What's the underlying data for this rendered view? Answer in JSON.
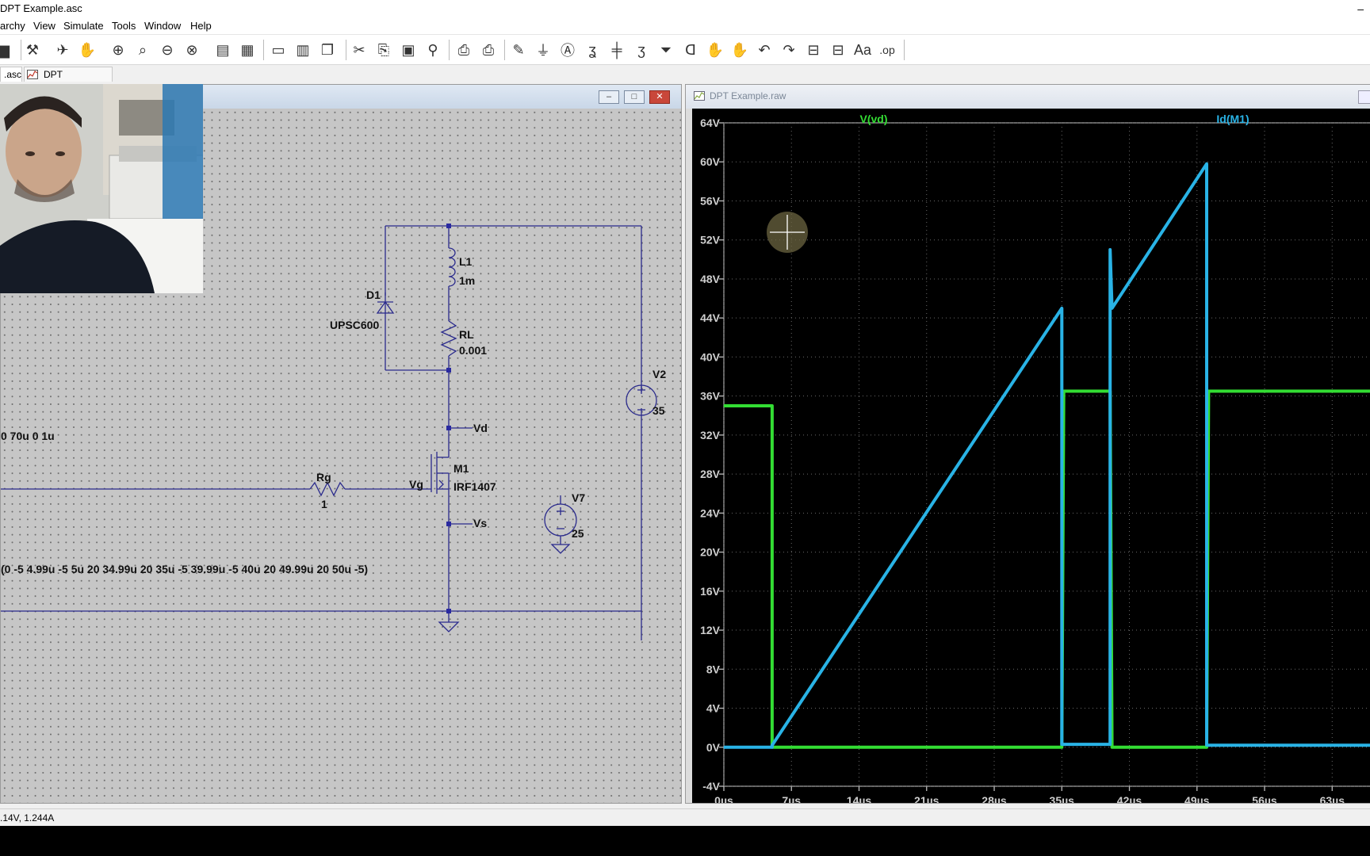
{
  "window": {
    "title": "DPT Example.asc",
    "minimize": "–"
  },
  "menu": [
    "archy",
    "View",
    "Simulate",
    "Tools",
    "Window",
    "Help"
  ],
  "tabs": [
    ".asc",
    "DPT Example.raw"
  ],
  "schematic": {
    "window_buttons": [
      "–",
      "□",
      "✕"
    ],
    "labels": {
      "l1": "L1",
      "l1_val": "1m",
      "d1": "D1",
      "d1_val": "UPSC600",
      "rl": "RL",
      "rl_val": "0.001",
      "v2": "V2",
      "v2_val": "35",
      "vd": "Vd",
      "vs": "Vs",
      "vg": "Vg",
      "m1": "M1",
      "m1_val": "IRF1407",
      "rg": "Rg",
      "rg_val": "1",
      "v7": "V7",
      "v7_val": "25",
      "pulse_frag": "0 70u 0 1u",
      "pwl": "(0 -5 4.99u -5 5u 20 34.99u 20 35u -5 39.99u -5 40u 20 49.99u 20 50u -5)"
    }
  },
  "waveform": {
    "title": "DPT Example.raw",
    "traces": [
      {
        "name": "V(vd)",
        "color": "#33dd33"
      },
      {
        "name": "Id(M1)",
        "color": "#29b3e6"
      }
    ]
  },
  "chart_data": {
    "type": "line",
    "xlabel": "",
    "ylabel": "",
    "xlim": [
      0,
      67
    ],
    "ylim": [
      -4,
      64
    ],
    "x_ticks": [
      "0µs",
      "7µs",
      "14µs",
      "21µs",
      "28µs",
      "35µs",
      "42µs",
      "49µs",
      "56µs",
      "63µs"
    ],
    "y_ticks": [
      "64V",
      "60V",
      "56V",
      "52V",
      "48V",
      "44V",
      "40V",
      "36V",
      "32V",
      "28V",
      "24V",
      "20V",
      "16V",
      "12V",
      "8V",
      "4V",
      "0V",
      "-4V"
    ],
    "grid": true,
    "series": [
      {
        "name": "V(vd)",
        "x": [
          0,
          5,
          5,
          35,
          35.2,
          40,
          40.2,
          50,
          50.2,
          67
        ],
        "y": [
          35,
          35,
          0,
          0,
          36.5,
          36.5,
          0,
          0,
          36.5,
          36.5
        ]
      },
      {
        "name": "Id(M1)",
        "x": [
          0,
          5,
          5,
          35,
          35,
          40,
          40,
          40.2,
          50,
          50,
          67
        ],
        "y": [
          0,
          0,
          0.2,
          45,
          0.3,
          0.3,
          51,
          45,
          59.8,
          0.2,
          0.2
        ]
      }
    ]
  },
  "status": {
    "readout": ".14V, 1.244A"
  }
}
